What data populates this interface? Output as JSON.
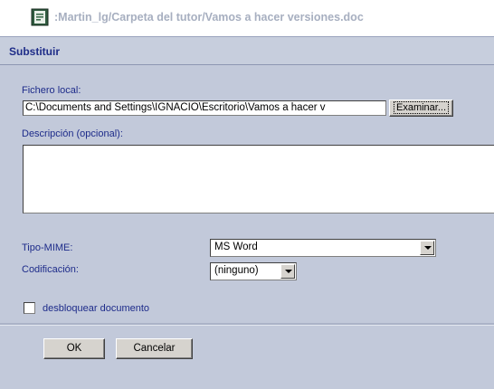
{
  "window": {
    "title": ":Martin_lg/Carpeta del tutor/Vamos a hacer versiones.doc",
    "icon": "document-icon"
  },
  "dialog": {
    "heading": "Substituir"
  },
  "form": {
    "file_label": "Fichero local:",
    "file_value": "C:\\Documents and Settings\\IGNACIO\\Escritorio\\Vamos a hacer v",
    "browse_button": "Examinar...",
    "description_label": "Descripción (opcional):",
    "description_value": "",
    "mime_label": "Tipo-MIME:",
    "mime_value": "MS Word",
    "encoding_label": "Codificación:",
    "encoding_value": "(ninguno)",
    "unlock_label": "desbloquear documento",
    "unlock_checked": false
  },
  "buttons": {
    "ok": "OK",
    "cancel": "Cancelar"
  },
  "colors": {
    "panel": "#c2c9da",
    "header": "#c7cedd",
    "label": "#1d2b8a",
    "title": "#a7afc0"
  }
}
